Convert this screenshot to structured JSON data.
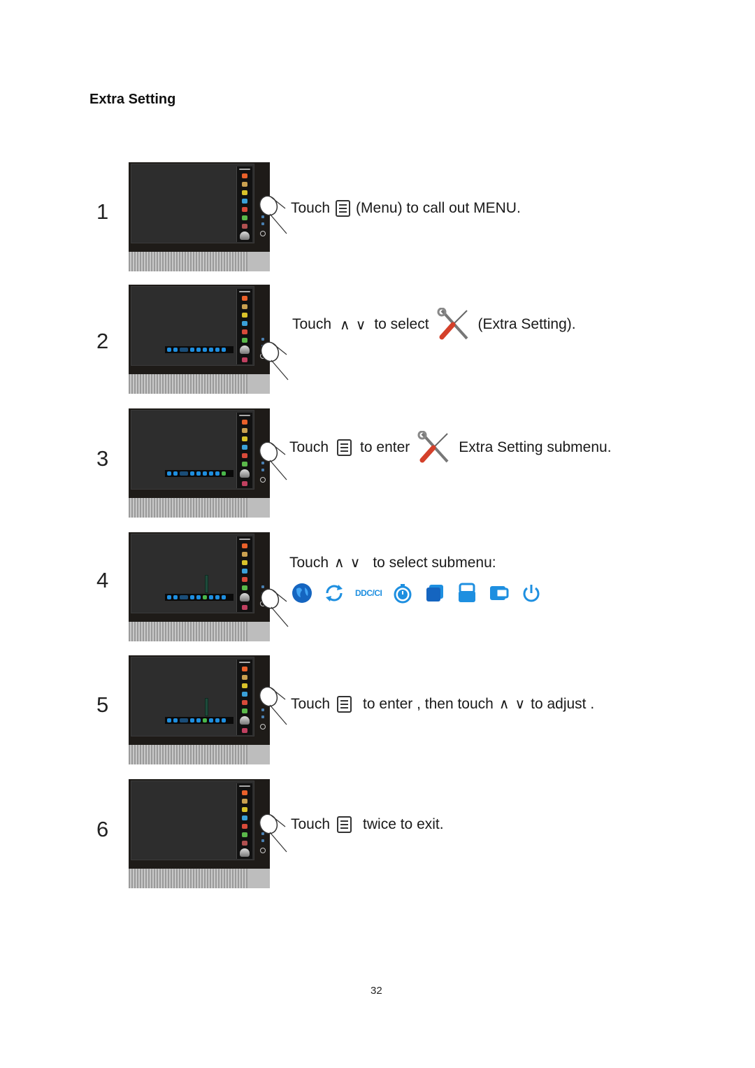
{
  "page": {
    "title": "Extra Setting",
    "page_number": "32"
  },
  "steps": [
    {
      "number": "1",
      "parts": [
        "Touch",
        "(Menu) to  call out MENU."
      ]
    },
    {
      "number": "2",
      "parts": [
        "Touch",
        "to select",
        "(Extra Setting)."
      ]
    },
    {
      "number": "3",
      "parts": [
        "Touch",
        "to enter",
        "Extra Setting  submenu."
      ]
    },
    {
      "number": "4",
      "parts": [
        "Touch",
        "to select submenu:"
      ],
      "submenu_icons": [
        "language-globe-icon",
        "reset-icon",
        "DDC/CI",
        "timer-icon",
        "image-ratio-icon",
        "input-select-icon",
        "dcr-icon",
        "power-icon"
      ],
      "ddc_label": "DDC/CI"
    },
    {
      "number": "5",
      "parts": [
        "Touch",
        "to enter , then touch",
        "to adjust ."
      ]
    },
    {
      "number": "6",
      "parts": [
        "Touch",
        "twice to exit."
      ]
    }
  ],
  "symbols": {
    "up": "∧",
    "down": "∨"
  },
  "colors": {
    "accent_blue": "#1e8fe0",
    "bezel": "#1e1b18",
    "screen": "#2d2d2d"
  }
}
